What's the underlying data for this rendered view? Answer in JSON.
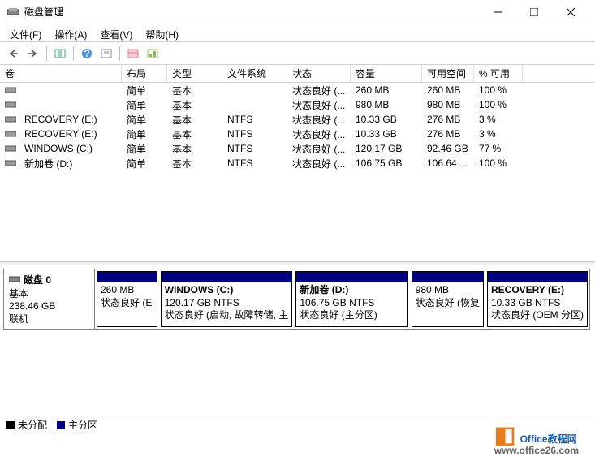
{
  "window": {
    "title": "磁盘管理"
  },
  "menu": {
    "file": "文件(F)",
    "action": "操作(A)",
    "view": "查看(V)",
    "help": "帮助(H)"
  },
  "columns": {
    "volume": "卷",
    "layout": "布局",
    "type": "类型",
    "filesystem": "文件系统",
    "status": "状态",
    "capacity": "容量",
    "free": "可用空间",
    "pctfree": "% 可用"
  },
  "volumes": [
    {
      "name": "",
      "layout": "简单",
      "type": "基本",
      "fs": "",
      "status": "状态良好 (...",
      "cap": "260 MB",
      "free": "260 MB",
      "pct": "100 %"
    },
    {
      "name": "",
      "layout": "简单",
      "type": "基本",
      "fs": "",
      "status": "状态良好 (...",
      "cap": "980 MB",
      "free": "980 MB",
      "pct": "100 %"
    },
    {
      "name": "RECOVERY (E:)",
      "layout": "简单",
      "type": "基本",
      "fs": "NTFS",
      "status": "状态良好 (...",
      "cap": "10.33 GB",
      "free": "276 MB",
      "pct": "3 %"
    },
    {
      "name": "RECOVERY (E:)",
      "layout": "简单",
      "type": "基本",
      "fs": "NTFS",
      "status": "状态良好 (...",
      "cap": "10.33 GB",
      "free": "276 MB",
      "pct": "3 %"
    },
    {
      "name": "WINDOWS (C:)",
      "layout": "简单",
      "type": "基本",
      "fs": "NTFS",
      "status": "状态良好 (...",
      "cap": "120.17 GB",
      "free": "92.46 GB",
      "pct": "77 %"
    },
    {
      "name": "新加卷 (D:)",
      "layout": "简单",
      "type": "基本",
      "fs": "NTFS",
      "status": "状态良好 (...",
      "cap": "106.75 GB",
      "free": "106.64 ...",
      "pct": "100 %"
    }
  ],
  "disk": {
    "label": "磁盘 0",
    "type": "基本",
    "size": "238.46 GB",
    "state": "联机",
    "parts": [
      {
        "title": "",
        "line2": "260 MB",
        "line3": "状态良好 (E",
        "flex": 0.8
      },
      {
        "title": "WINDOWS  (C:)",
        "line2": "120.17 GB NTFS",
        "line3": "状态良好 (启动, 故障转储, 主",
        "flex": 1.6
      },
      {
        "title": "新加卷  (D:)",
        "line2": "106.75 GB NTFS",
        "line3": "状态良好 (主分区)",
        "flex": 1.5
      },
      {
        "title": "",
        "line2": "980 MB",
        "line3": "状态良好 (恢复",
        "flex": 0.9
      },
      {
        "title": "RECOVERY  (E:)",
        "line2": "10.33 GB NTFS",
        "line3": "状态良好 (OEM 分区)",
        "flex": 1.3
      }
    ]
  },
  "legend": {
    "unalloc": "未分配",
    "primary": "主分区"
  },
  "watermark": {
    "text1": "Office",
    "text2": "教程网",
    "url": "www.office26.com"
  }
}
